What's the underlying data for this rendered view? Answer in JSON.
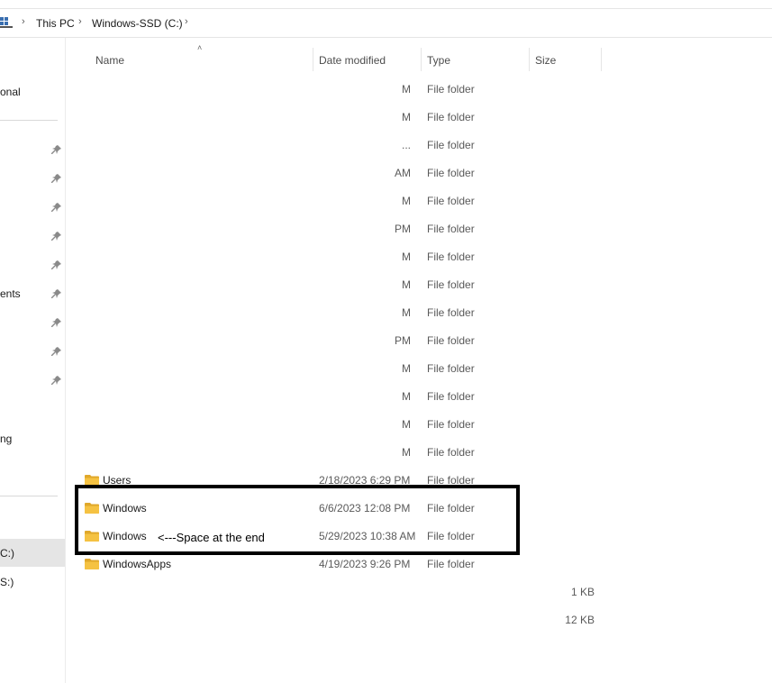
{
  "breadcrumb": {
    "items": [
      "This PC",
      "Windows-SSD (C:)"
    ]
  },
  "nav": {
    "items": [
      {
        "label": "onal"
      },
      {
        "label": "ents"
      },
      {
        "label": "ng"
      },
      {
        "label": "C:)"
      },
      {
        "label": "S:)"
      }
    ]
  },
  "columns": {
    "name": "Name",
    "date": "Date modified",
    "type": "Type",
    "size": "Size"
  },
  "rows": [
    {
      "date_frag": "M",
      "type": "File folder"
    },
    {
      "date_frag": "M",
      "type": "File folder"
    },
    {
      "date_frag": "...",
      "type": "File folder"
    },
    {
      "date_frag": "AM",
      "type": "File folder"
    },
    {
      "date_frag": "M",
      "type": "File folder"
    },
    {
      "date_frag": "PM",
      "type": "File folder"
    },
    {
      "date_frag": "M",
      "type": "File folder"
    },
    {
      "date_frag": "M",
      "type": "File folder"
    },
    {
      "date_frag": "M",
      "type": "File folder"
    },
    {
      "date_frag": "PM",
      "type": "File folder"
    },
    {
      "date_frag": "M",
      "type": "File folder"
    },
    {
      "date_frag": "M",
      "type": "File folder"
    },
    {
      "date_frag": "M",
      "type": "File folder"
    },
    {
      "date_frag": "M",
      "type": "File folder"
    },
    {
      "name": "Users",
      "date": "2/18/2023 6:29 PM",
      "type": "File folder"
    },
    {
      "name": "Windows",
      "date": "6/6/2023 12:08 PM",
      "type": "File folder"
    },
    {
      "name": "Windows",
      "date": "5/29/2023 10:38 AM",
      "type": "File folder"
    },
    {
      "name": "WindowsApps",
      "date": "4/19/2023 9:26 PM",
      "type": "File folder"
    },
    {
      "size": "1 KB"
    },
    {
      "size": "12 KB"
    }
  ],
  "annotation": {
    "text": "<---Space at the end"
  },
  "colors": {
    "folder": "#f5c242",
    "folder_dark": "#e0a82b",
    "selected_bg": "#e5e5e5"
  }
}
